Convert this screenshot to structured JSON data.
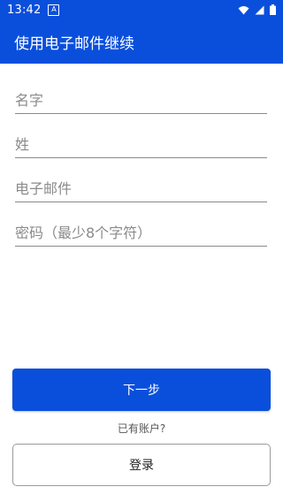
{
  "status_bar": {
    "time": "13:42",
    "notification_icon": "a-letter-icon",
    "icons": [
      "wifi-icon",
      "signal-icon",
      "battery-icon"
    ]
  },
  "app_bar": {
    "title": "使用电子邮件继续",
    "background_color": "#0a4fdc"
  },
  "form": {
    "first_name_placeholder": "名字",
    "last_name_placeholder": "姓",
    "email_placeholder": "电子邮件",
    "password_placeholder": "密码（最少8个字符）"
  },
  "actions": {
    "next_label": "下一步",
    "have_account_text": "已有账户?",
    "login_label": "登录"
  }
}
